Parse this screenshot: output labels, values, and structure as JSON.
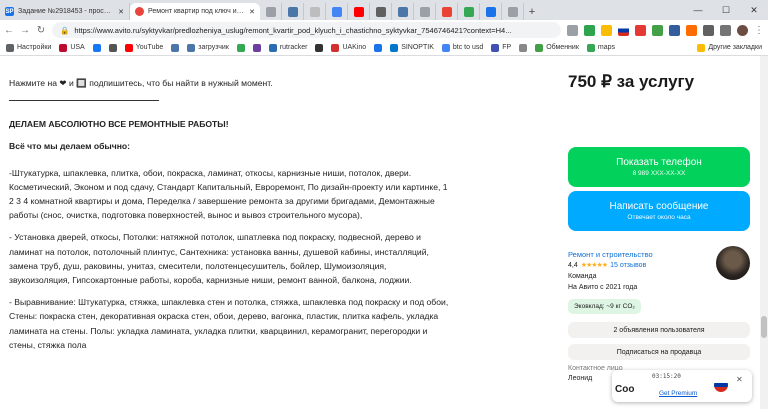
{
  "tabs": [
    {
      "label": "Задание №2918453 - просмотр з",
      "favicon": "SP",
      "color": "#1a73e8"
    },
    {
      "label": "Ремонт квартир под ключ и части",
      "favicon": "",
      "color": "#e8453c",
      "active": true
    }
  ],
  "address": {
    "url": "https://www.avito.ru/syktyvkar/predlozheniya_uslug/remont_kvartir_pod_klyuch_i_chastichno_syktyvkar_7546746421?context=H4..."
  },
  "bookmarks": [
    {
      "label": "Настройки",
      "color": "#5f6368"
    },
    {
      "label": "USA",
      "color": "#bf0a30"
    },
    {
      "label": "",
      "color": "#1877f2"
    },
    {
      "label": "",
      "color": "#555"
    },
    {
      "label": "YouTube",
      "color": "#ff0000"
    },
    {
      "label": "",
      "color": "#4a76a8"
    },
    {
      "label": "загрузчик",
      "color": "#4a76a8"
    },
    {
      "label": "",
      "color": "#34a853"
    },
    {
      "label": "",
      "color": "#6b3fa0"
    },
    {
      "label": "rutracker",
      "color": "#2a6db0"
    },
    {
      "label": "",
      "color": "#333"
    },
    {
      "label": "UAKino",
      "color": "#d32f2f"
    },
    {
      "label": "",
      "color": "#1a73e8"
    },
    {
      "label": "SINOPTIK",
      "color": "#0077c8"
    },
    {
      "label": "btc to usd",
      "color": "#4285f4"
    },
    {
      "label": "FP",
      "color": "#3f51b5"
    },
    {
      "label": "",
      "color": "#888"
    },
    {
      "label": "Обменник",
      "color": "#43a047"
    },
    {
      "label": "maps",
      "color": "#34a853"
    }
  ],
  "bookmarks_end": "Другие закладки",
  "content": {
    "cut_line": "Нажмите на ❤ и 🔲 подпишитесь, что бы найти в нужный момент.",
    "heading": "ДЕЛАЕМ АБСОЛЮТНО ВСЕ РЕМОНТНЫЕ РАБОТЫ!",
    "subheading": "Всё что мы делаем обычно:",
    "para1": "-Штукатурка, шпаклевка, плитка, обои, покраска, ламинат, откосы, карнизные ниши, потолок, двери. Косметический, Эконом и под сдачу, Стандарт Капитальный, Евроремонт, По дизайн-проекту или картинке, 1 2 3 4 комнатной квартиры и дома, Переделка / завершение ремонта за другими бригадами, Демонтажные работы (снос, очистка, подготовка поверхностей, вынос и вывоз строительного мусора),",
    "para2": "- Установка дверей, откосы, Потолки: натяжной потолок, шпатлевка под покраску, подвесной, дерево и ламинат на потолок, потолочный плинтус, Сантехника: установка ванны, душевой кабины, инсталляций, замена труб, душ, раковины, унитаз, смесители, полотенцесушитель, бойлер, Шумоизоляция, звукоизоляция, Гипсокартонные работы, короба, карнизные ниши, ремонт ванной, балкона, лоджии.",
    "para3": "- Выравнивание: Штукатурка, стяжка, шпаклевка стен и потолка, стяжка, шпаклевка под покраску и под обои, Стены: покраска стен, декоративная окраска стен, обои, дерево, вагонка, пластик, плитка кафель, укладка ламината на стены. Полы: укладка ламината, укладка плитки, кварцвинил, керамогранит, перегородки и стены, стяжка пола"
  },
  "sidebar": {
    "price": "750 ₽ за услугу",
    "phone_btn": "Показать телефон",
    "phone_number": "8 989 XXX-XX-XX",
    "msg_btn": "Написать сообщение",
    "msg_sub": "Отвечает около часа",
    "seller_name": "Ремонт и строительство",
    "rating_value": "4,4",
    "stars": "★★★★★",
    "reviews": "15 отзывов",
    "seller_type": "Команда",
    "since": "На Авито с 2021 года",
    "eco": "Эковклад: ~9 кг CO₂",
    "ads_btn": "2 объявления пользователя",
    "subscribe_btn": "Подписаться на продавца",
    "contact_label": "Контактное лицо",
    "contact_name": "Леонид"
  },
  "overlay": {
    "time": "03:15:20",
    "link": "Get Premium",
    "so_text": "Соо"
  },
  "window_controls": [
    "—",
    "☐",
    "✕"
  ]
}
